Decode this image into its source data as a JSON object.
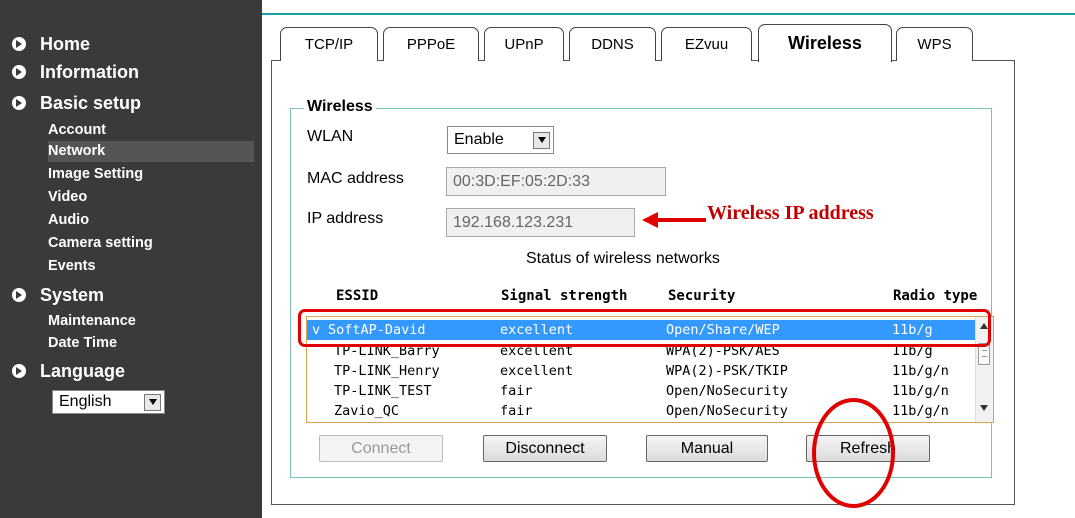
{
  "sidebar": {
    "main": [
      {
        "label": "Home"
      },
      {
        "label": "Information"
      },
      {
        "label": "Basic setup"
      },
      {
        "label": "System"
      },
      {
        "label": "Language"
      }
    ],
    "basic_sub": [
      "Account",
      "Network",
      "Image Setting",
      "Video",
      "Audio",
      "Camera setting",
      "Events"
    ],
    "system_sub": [
      "Maintenance",
      "Date Time"
    ],
    "language_value": "English"
  },
  "tabs": [
    "TCP/IP",
    "PPPoE",
    "UPnP",
    "DDNS",
    "EZvuu",
    "Wireless",
    "WPS"
  ],
  "wireless": {
    "legend": "Wireless",
    "wlan_label": "WLAN",
    "wlan_value": "Enable",
    "mac_label": "MAC address",
    "mac_value": "00:3D:EF:05:2D:33",
    "ip_label": "IP address",
    "ip_value": "192.168.123.231",
    "status_title": "Status of wireless networks",
    "columns": [
      "ESSID",
      "Signal strength",
      "Security",
      "Radio type"
    ],
    "networks": [
      {
        "mark": "v",
        "essid": "SoftAP-David",
        "signal": "excellent",
        "security": "Open/Share/WEP",
        "radio": "11b/g"
      },
      {
        "mark": "",
        "essid": "TP-LINK_Barry",
        "signal": "excellent",
        "security": "WPA(2)-PSK/AES",
        "radio": "11b/g"
      },
      {
        "mark": "",
        "essid": "TP-LINK_Henry",
        "signal": "excellent",
        "security": "WPA(2)-PSK/TKIP",
        "radio": "11b/g/n"
      },
      {
        "mark": "",
        "essid": "TP-LINK_TEST",
        "signal": "fair",
        "security": "Open/NoSecurity",
        "radio": "11b/g/n"
      },
      {
        "mark": "",
        "essid": "Zavio_QC",
        "signal": "fair",
        "security": "Open/NoSecurity",
        "radio": "11b/g/n"
      }
    ],
    "buttons": {
      "connect": "Connect",
      "disconnect": "Disconnect",
      "manual": "Manual",
      "refresh": "Refresh"
    }
  },
  "annotation": {
    "text": "Wireless IP address",
    "color": "#c00000"
  },
  "colors": {
    "sidebar_bg": "#3a3a3a",
    "selected_row": "#3399ff",
    "accent": "#1aa0a0",
    "highlight": "#e00000"
  }
}
